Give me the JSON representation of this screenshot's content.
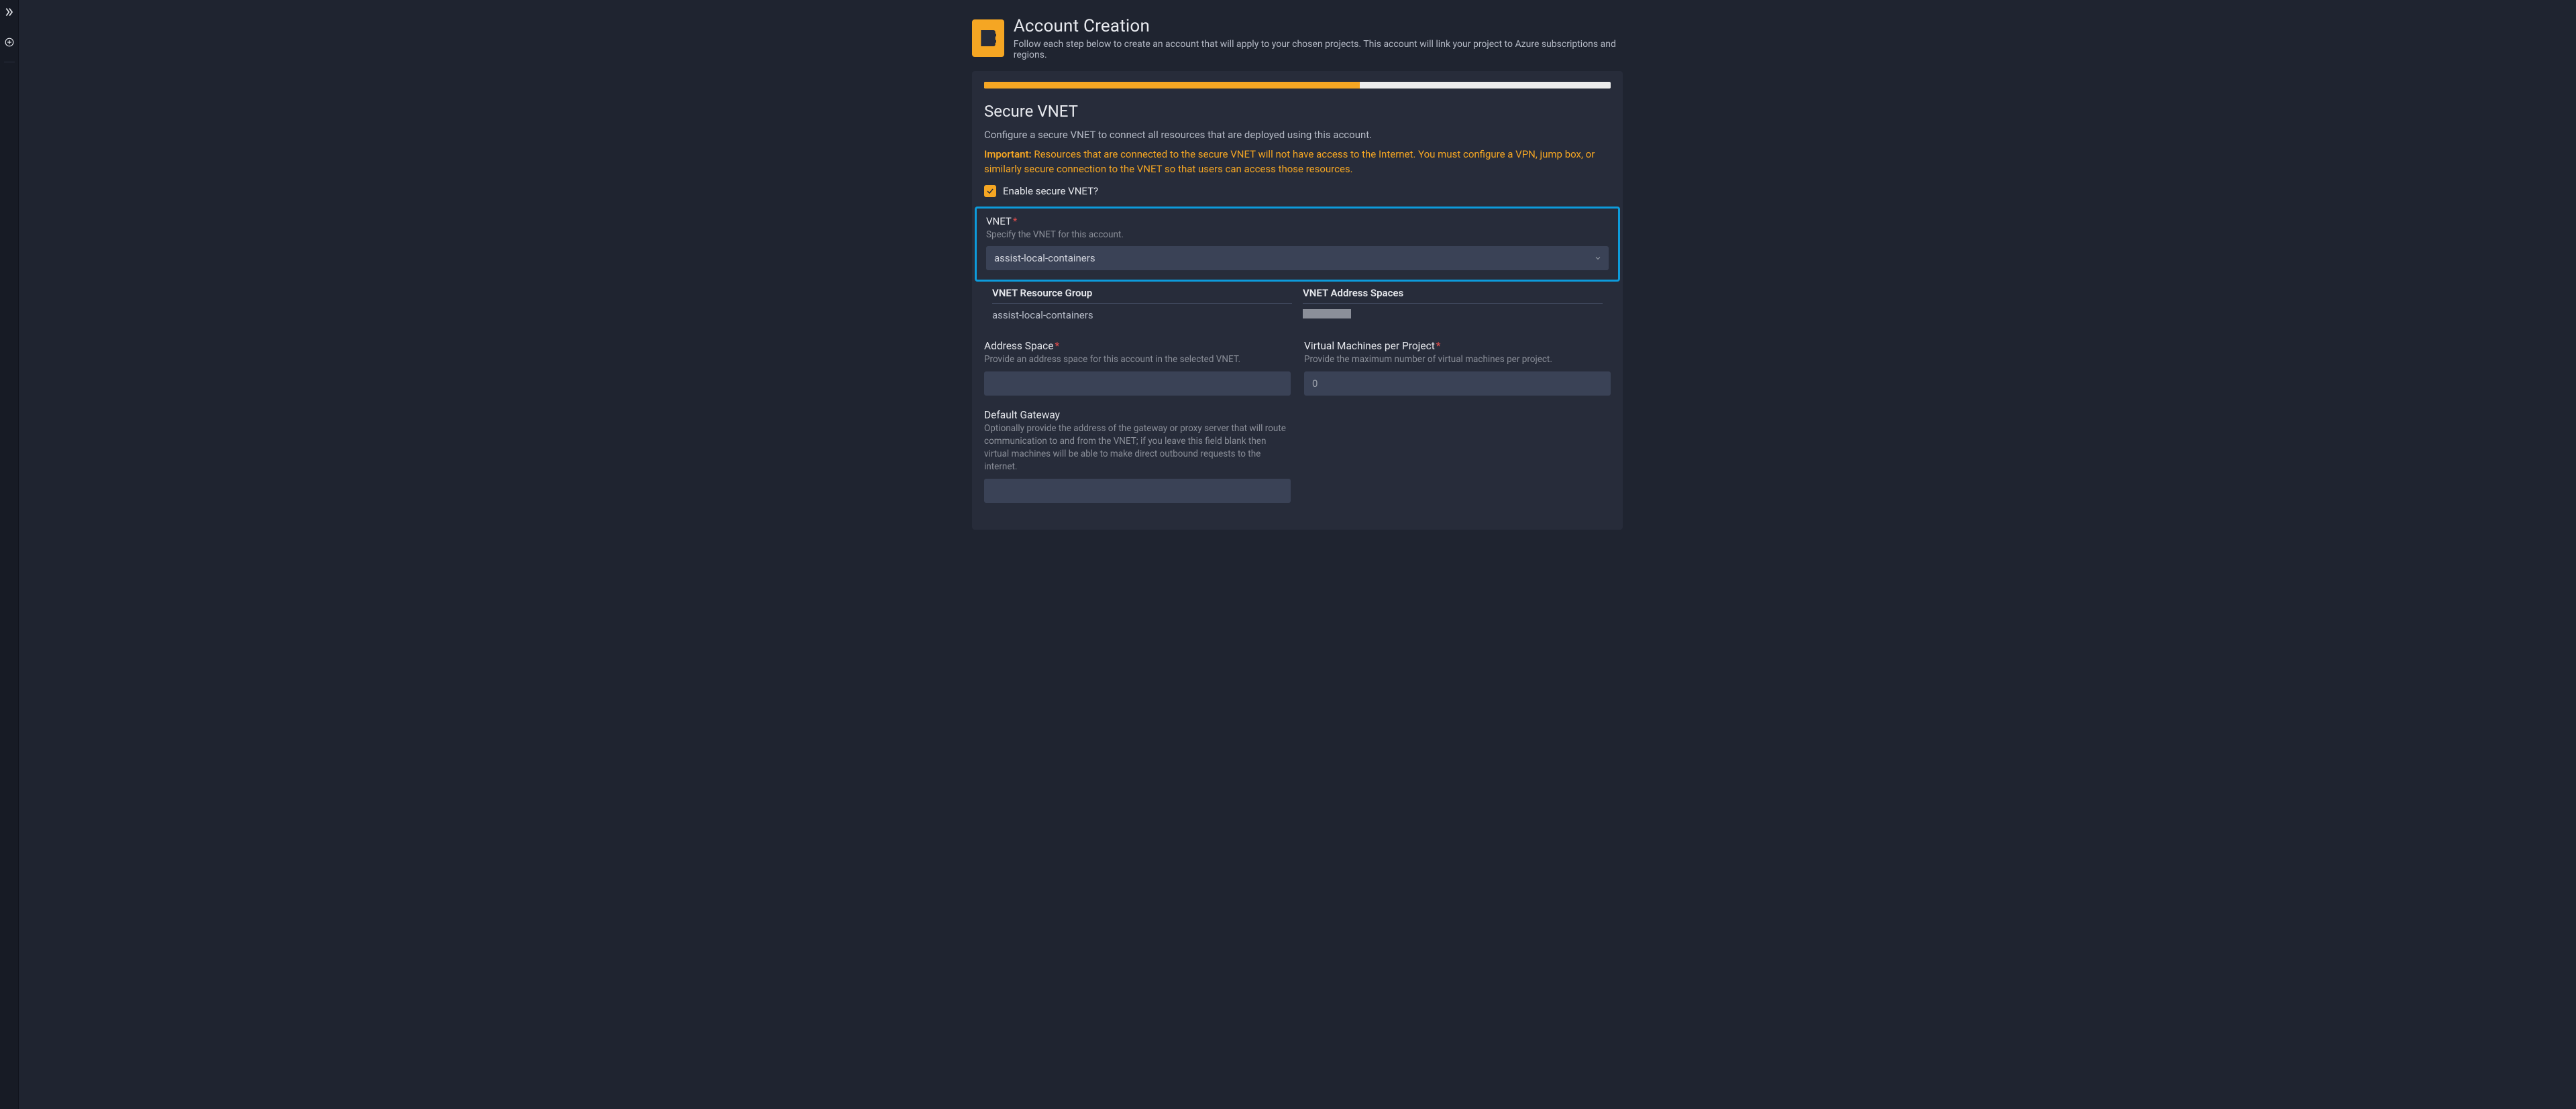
{
  "header": {
    "title": "Account Creation",
    "subtitle": "Follow each step below to create an account that will apply to your chosen projects. This account will link your project to Azure subscriptions and regions."
  },
  "progress": {
    "percent": 60
  },
  "step": {
    "title": "Secure VNET",
    "description": "Configure a secure VNET to connect all resources that are deployed using this account.",
    "important_label": "Important:",
    "important_text": " Resources that are connected to the secure VNET will not have access to the Internet. You must configure a VPN, jump box, or similarly secure connection to the VNET so that users can access those resources.",
    "enable_label": "Enable secure VNET?",
    "enable_checked": true
  },
  "vnet": {
    "field_label": "VNET",
    "help": "Specify the VNET for this account.",
    "selected": "assist-local-containers",
    "resource_group_heading": "VNET Resource Group",
    "resource_group_value": "assist-local-containers",
    "address_spaces_heading": "VNET Address Spaces"
  },
  "address_space": {
    "label": "Address Space",
    "help": "Provide an address space for this account in the selected VNET.",
    "value": ""
  },
  "vm_per_project": {
    "label": "Virtual Machines per Project",
    "help": "Provide the maximum number of virtual machines per project.",
    "value": "",
    "placeholder": "0"
  },
  "default_gateway": {
    "label": "Default Gateway",
    "help": "Optionally provide the address of the gateway or proxy server that will route communication to and from the VNET; if you leave this field blank then virtual machines will be able to make direct outbound requests to the internet.",
    "value": ""
  }
}
